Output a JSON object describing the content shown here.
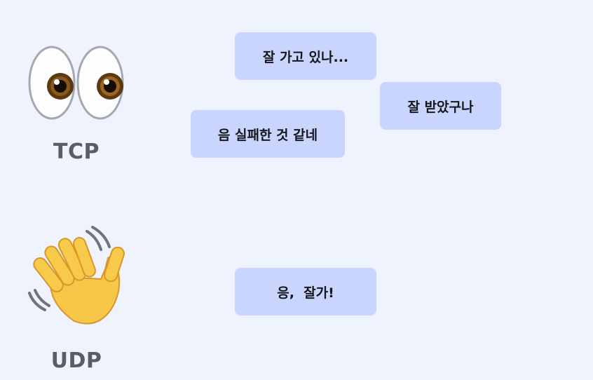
{
  "tcp": {
    "label": "TCP",
    "icon": "eyes-icon",
    "messages": [
      "잘 가고 있나...",
      "잘 받았구나",
      "음 실패한 것 같네"
    ]
  },
  "udp": {
    "label": "UDP",
    "icon": "waving-hand-icon",
    "messages": [
      "응,  잘가!"
    ]
  },
  "colors": {
    "background": "#eef3fd",
    "bubble": "#c9d5fc",
    "label": "#585d68",
    "text": "#15171c"
  }
}
